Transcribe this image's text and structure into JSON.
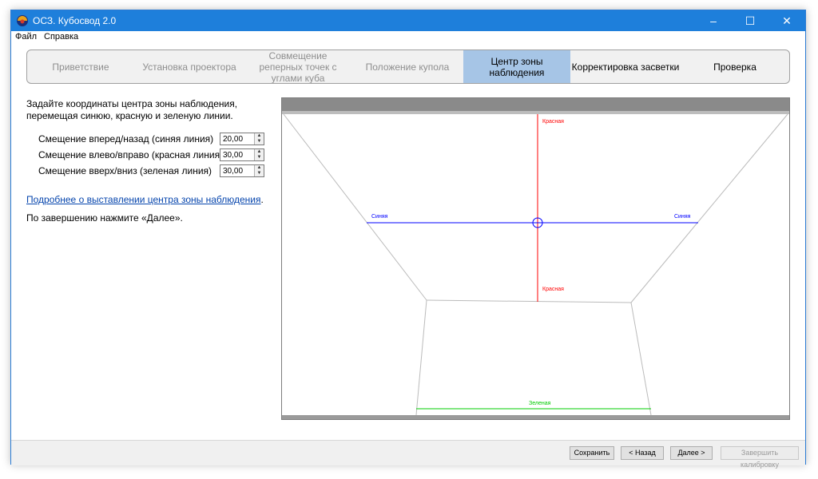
{
  "window": {
    "title": "ОСЗ. Кубосвод 2.0",
    "controls": {
      "minimize": "–",
      "maximize": "☐",
      "close": "✕"
    },
    "accent": "#1e7fdb"
  },
  "menu": {
    "file": "Файл",
    "help": "Справка"
  },
  "steps": [
    {
      "label": "Приветствие",
      "state": "done"
    },
    {
      "label": "Установка проектора",
      "state": "done"
    },
    {
      "label": "Совмещение реперных точек с углами куба",
      "state": "done"
    },
    {
      "label": "Положение купола",
      "state": "done"
    },
    {
      "label": "Центр зоны наблюдения",
      "state": "active"
    },
    {
      "label": "Корректировка засветки",
      "state": "future"
    },
    {
      "label": "Проверка",
      "state": "future"
    }
  ],
  "instructions": "Задайте координаты центра зоны наблюдения, перемещая синюю, красную и зеленую линии.",
  "fields": [
    {
      "label": "Смещение вперед/назад (синяя линия)",
      "value": "20,00"
    },
    {
      "label": "Смещение влево/вправо (красная линия)",
      "value": "30,00"
    },
    {
      "label": "Смещение вверх/вниз (зеленая линия)",
      "value": "30,00"
    }
  ],
  "link_text": "Подробнее о выставлении центра зоны наблюдения",
  "link_suffix": ".",
  "finish_note": "По завершению нажмите «Далее».",
  "view": {
    "labels": {
      "red_top": "Красная",
      "red_bottom": "Красная",
      "blue_left": "Синяя",
      "blue_right": "Синяя",
      "green": "Зеленая"
    },
    "colors": {
      "red": "#ff0000",
      "blue": "#0000ff",
      "green": "#00cc00",
      "edge": "#bbbbbb",
      "band": "#8a8a8a"
    }
  },
  "buttons": {
    "save": "Сохранить",
    "back": "< Назад",
    "next": "Далее >",
    "finish": "Завершить калибровку"
  }
}
